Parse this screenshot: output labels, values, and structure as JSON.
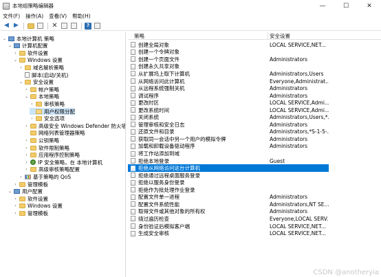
{
  "window": {
    "title": "本地组策略编辑器",
    "controls": [
      "—",
      "☐",
      "✕"
    ]
  },
  "menubar": {
    "items": [
      "文件(F)",
      "操作(A)",
      "查看(V)",
      "帮助(H)"
    ]
  },
  "tree": {
    "items": [
      {
        "label": "本地计算机 策略",
        "level": 0,
        "icon": "computer",
        "expanded": true
      },
      {
        "label": "计算机配置",
        "level": 1,
        "icon": "computer",
        "expanded": true
      },
      {
        "label": "软件设置",
        "level": 2,
        "icon": "folder",
        "expanded": false
      },
      {
        "label": "Windows 设置",
        "level": 2,
        "icon": "folder",
        "expanded": true
      },
      {
        "label": "域名解析策略",
        "level": 3,
        "icon": "folder",
        "expanded": false
      },
      {
        "label": "脚本(启动/关机)",
        "level": 3,
        "icon": "doc",
        "expanded": null
      },
      {
        "label": "安全设置",
        "level": 3,
        "icon": "folder",
        "expanded": true
      },
      {
        "label": "帐户策略",
        "level": 4,
        "icon": "folder",
        "expanded": false
      },
      {
        "label": "本地策略",
        "level": 4,
        "icon": "folder",
        "expanded": true
      },
      {
        "label": "审核策略",
        "level": 5,
        "icon": "folder",
        "expanded": false
      },
      {
        "label": "用户权限分配",
        "level": 5,
        "icon": "folder-open",
        "expanded": null,
        "selected": true
      },
      {
        "label": "安全选项",
        "level": 5,
        "icon": "folder",
        "expanded": false
      },
      {
        "label": "高级安全 Windows Defender 防火墙",
        "level": 4,
        "icon": "folder",
        "expanded": false
      },
      {
        "label": "网络列表管理器策略",
        "level": 4,
        "icon": "folder",
        "expanded": null
      },
      {
        "label": "公钥策略",
        "level": 4,
        "icon": "folder",
        "expanded": false
      },
      {
        "label": "软件限制策略",
        "level": 4,
        "icon": "folder",
        "expanded": false
      },
      {
        "label": "应用程序控制策略",
        "level": 4,
        "icon": "folder",
        "expanded": false
      },
      {
        "label": "IP 安全策略，在 本地计算机",
        "level": 4,
        "icon": "net",
        "expanded": false
      },
      {
        "label": "高级审核策略配置",
        "level": 4,
        "icon": "folder",
        "expanded": false
      },
      {
        "label": "基于策略的 QoS",
        "level": 3,
        "icon": "bars",
        "expanded": false
      },
      {
        "label": "管理模板",
        "level": 2,
        "icon": "folder",
        "expanded": false
      },
      {
        "label": "用户配置",
        "level": 1,
        "icon": "computer",
        "expanded": true
      },
      {
        "label": "软件设置",
        "level": 2,
        "icon": "folder",
        "expanded": false
      },
      {
        "label": "Windows 设置",
        "level": 2,
        "icon": "folder",
        "expanded": false
      },
      {
        "label": "管理模板",
        "level": 2,
        "icon": "folder",
        "expanded": false
      }
    ]
  },
  "policies": {
    "columns": {
      "policy": "策略",
      "setting": "安全设置"
    },
    "rows": [
      {
        "name": "创建全局对象",
        "value": "LOCAL SERVICE,NET..."
      },
      {
        "name": "创建一个令牌对象",
        "value": ""
      },
      {
        "name": "创建一个页面文件",
        "value": "Administrators"
      },
      {
        "name": "创建永久共享对象",
        "value": ""
      },
      {
        "name": "从扩展坞上取下计算机",
        "value": "Administrators,Users"
      },
      {
        "name": "从网络访问此计算机",
        "value": "Everyone,Administrat..."
      },
      {
        "name": "从远程系统强制关机",
        "value": "Administrators"
      },
      {
        "name": "调试程序",
        "value": "Administrators"
      },
      {
        "name": "更改时区",
        "value": "LOCAL SERVICE,Admi..."
      },
      {
        "name": "更改系统时间",
        "value": "LOCAL SERVICE,Admi..."
      },
      {
        "name": "关闭系统",
        "value": "Administrators,Users,*..."
      },
      {
        "name": "管理审核和安全日志",
        "value": "Administrators"
      },
      {
        "name": "还原文件和目录",
        "value": "Administrators,*S-1-5-..."
      },
      {
        "name": "获取同一会话中另一个用户的模拟令牌",
        "value": "Administrators"
      },
      {
        "name": "加载和卸载设备驱动程序",
        "value": "Administrators"
      },
      {
        "name": "将工作站添加到域",
        "value": ""
      },
      {
        "name": "拒绝本地登录",
        "value": "Guest"
      },
      {
        "name": "拒绝从网络访问这台计算机",
        "value": "",
        "selected": true
      },
      {
        "name": "拒绝通过远程桌面服务登录",
        "value": ""
      },
      {
        "name": "拒绝以服务身份登录",
        "value": ""
      },
      {
        "name": "拒绝作为批处理作业登录",
        "value": ""
      },
      {
        "name": "配置文件单一进程",
        "value": "Administrators"
      },
      {
        "name": "配置文件系统性能",
        "value": "Administrators,NT SE..."
      },
      {
        "name": "取得文件或其他对象的所有权",
        "value": "Administrators"
      },
      {
        "name": "绕过遍历检查",
        "value": "Everyone,LOCAL SERV..."
      },
      {
        "name": "身份验证后模拟客户端",
        "value": "LOCAL SERVICE,NET..."
      },
      {
        "name": "生成安全审核",
        "value": "LOCAL SERVICE,NET..."
      }
    ]
  },
  "watermark": "CSDN @anotheryia"
}
